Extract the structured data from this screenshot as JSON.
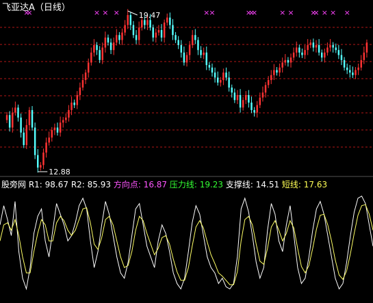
{
  "colors": {
    "background": "#000000",
    "up_candle": "#ff3333",
    "down_candle": "#55ffff",
    "signal_marker": "#ff44ff",
    "gridline": "#ff2020",
    "white_line": "#ffffff",
    "yellow_line": "#ffff66",
    "label_white": "#ffffff",
    "label_pink": "#ff55ff",
    "label_green": "#33ff33",
    "label_yellow": "#ffff55"
  },
  "chart_data": [
    {
      "type": "candlestick",
      "title": "飞亚达A（日线）",
      "period": "日线",
      "annotations": {
        "high": "19.47",
        "low": "12.88"
      },
      "high_value": 19.47,
      "low_value": 12.88,
      "signal_marker_symbol": "×",
      "gridlines": "dashed horizontal",
      "closes": [
        15.1,
        14.6,
        15.2,
        15.4,
        15.0,
        14.4,
        13.9,
        14.7,
        15.3,
        14.6,
        13.5,
        13.0,
        13.1,
        13.6,
        14.0,
        14.2,
        14.5,
        14.6,
        14.4,
        14.8,
        14.9,
        15.0,
        15.3,
        15.6,
        15.5,
        15.9,
        16.2,
        16.5,
        16.8,
        17.2,
        17.6,
        17.9,
        17.7,
        17.3,
        17.8,
        18.2,
        18.0,
        17.7,
        18.0,
        18.3,
        18.1,
        18.4,
        18.7,
        19.1,
        18.7,
        18.3,
        18.1,
        18.6,
        18.9,
        18.7,
        18.9,
        18.6,
        18.2,
        18.4,
        18.5,
        18.2,
        18.8,
        19.0,
        18.7,
        18.3,
        18.1,
        17.9,
        17.6,
        17.2,
        17.5,
        17.9,
        18.3,
        18.1,
        17.7,
        17.5,
        17.6,
        17.1,
        17.0,
        16.8,
        16.6,
        16.4,
        16.5,
        16.8,
        16.6,
        16.2,
        16.0,
        15.7,
        15.9,
        15.4,
        15.7,
        15.9,
        15.6,
        15.3,
        15.2,
        15.5,
        15.8,
        16.0,
        16.3,
        16.5,
        16.7,
        16.9,
        16.8,
        17.0,
        17.2,
        17.3,
        17.2,
        17.4,
        17.6,
        17.8,
        17.6,
        17.5,
        17.7,
        17.9,
        18.0,
        17.8,
        17.9,
        17.6,
        17.4,
        17.6,
        17.8,
        17.9,
        17.8,
        17.7,
        17.5,
        17.3,
        17.0,
        16.9,
        16.8,
        16.7,
        16.9,
        17.0,
        17.3,
        17.6,
        18.0
      ],
      "signal_indices": [
        7,
        8,
        32,
        35,
        39,
        71,
        73,
        86,
        87,
        88,
        98,
        101,
        109,
        110,
        113,
        116,
        121
      ]
    },
    {
      "type": "line",
      "indicator": "股旁网",
      "legend": [
        {
          "name": "R1",
          "value": "98.67",
          "color_key": "label_white"
        },
        {
          "name": "R2",
          "value": "85.93",
          "color_key": "label_white"
        },
        {
          "name": "方向点",
          "value": "16.87",
          "color_key": "label_pink"
        },
        {
          "name": "压力线",
          "value": "19.23",
          "color_key": "label_green"
        },
        {
          "name": "支撑线",
          "value": "14.51",
          "color_key": "label_white"
        },
        {
          "name": "短线",
          "value": "17.63",
          "color_key": "label_yellow"
        }
      ],
      "ylim": [
        0,
        100
      ],
      "series": [
        {
          "color_key": "white_line",
          "values": [
            70,
            88,
            75,
            60,
            92,
            45,
            20,
            10,
            30,
            62,
            78,
            85,
            55,
            40,
            65,
            90,
            80,
            70,
            55,
            60,
            72,
            88,
            95,
            85,
            55,
            30,
            45,
            70,
            92,
            80,
            60,
            40,
            25,
            20,
            35,
            60,
            85,
            90,
            70,
            50,
            40,
            30,
            55,
            70,
            62,
            45,
            25,
            15,
            10,
            20,
            45,
            72,
            88,
            80,
            60,
            40,
            30,
            25,
            15,
            20,
            12,
            10,
            15,
            40,
            85,
            95,
            82,
            60,
            35,
            20,
            30,
            65,
            90,
            80,
            55,
            45,
            70,
            88,
            60,
            30,
            15,
            20,
            40,
            65,
            85,
            92,
            80,
            60,
            40,
            20,
            10,
            15,
            35,
            60,
            82,
            95,
            97,
            90,
            70,
            50
          ]
        },
        {
          "color_key": "yellow_line",
          "values": [
            55,
            70,
            72,
            65,
            75,
            60,
            40,
            25,
            25,
            45,
            62,
            75,
            70,
            55,
            55,
            72,
            78,
            74,
            65,
            60,
            65,
            75,
            85,
            86,
            72,
            52,
            47,
            58,
            75,
            78,
            70,
            55,
            40,
            30,
            32,
            45,
            65,
            78,
            74,
            62,
            52,
            42,
            48,
            58,
            60,
            52,
            38,
            26,
            18,
            18,
            30,
            50,
            68,
            74,
            67,
            54,
            42,
            34,
            25,
            22,
            18,
            14,
            14,
            26,
            55,
            75,
            78,
            70,
            52,
            36,
            33,
            48,
            68,
            74,
            65,
            55,
            62,
            74,
            67,
            48,
            31,
            25,
            32,
            48,
            66,
            79,
            80,
            70,
            55,
            37,
            23,
            19,
            27,
            43,
            62,
            79,
            88,
            89,
            80,
            65
          ]
        }
      ]
    }
  ]
}
